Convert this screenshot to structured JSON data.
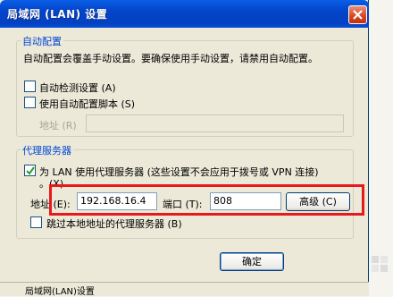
{
  "window": {
    "title": "局域网 (LAN) 设置"
  },
  "auto_config": {
    "group_title": "自动配置",
    "description": "自动配置会覆盖手动设置。要确保使用手动设置，请禁用自动配置。",
    "auto_detect_label": "自动检测设置 (A)",
    "auto_detect_checked": false,
    "use_script_label": "使用自动配置脚本 (S)",
    "use_script_checked": false,
    "address_label": "地址 (R)",
    "address_value": ""
  },
  "proxy": {
    "group_title": "代理服务器",
    "use_proxy_label_line1": "为 LAN 使用代理服务器 (这些设置不会应用于拨号或 VPN 连接)",
    "use_proxy_label_line2": "。(X)",
    "use_proxy_checked": true,
    "address_label": "地址 (E):",
    "address_value": "192.168.16.4",
    "port_label": "端口 (T):",
    "port_value": "808",
    "advanced_label": "高级 (C)",
    "bypass_label": "跳过本地地址的代理服务器 (B)",
    "bypass_checked": false
  },
  "buttons": {
    "ok_label": "确定"
  },
  "background_window": {
    "title": "局域网(LAN)设置"
  },
  "colors": {
    "titlebar": "#0a5ee6",
    "group_title": "#0046d5",
    "highlight": "#e8181c",
    "dialog_bg": "#ece9d8"
  }
}
